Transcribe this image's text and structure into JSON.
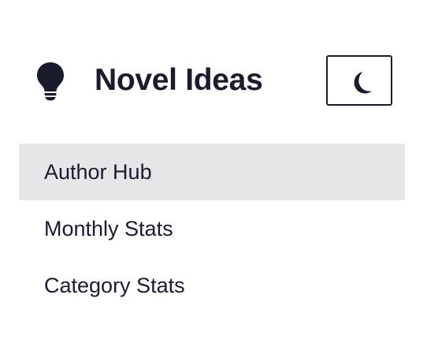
{
  "app": {
    "title": "Novel Ideas",
    "logo_icon": "lightbulb-icon"
  },
  "theme_toggle": {
    "icon": "moon-icon"
  },
  "nav": {
    "items": [
      {
        "label": "Author Hub",
        "active": true
      },
      {
        "label": "Monthly Stats",
        "active": false
      },
      {
        "label": "Category Stats",
        "active": false
      }
    ]
  },
  "colors": {
    "text": "#1a1c2e",
    "active_background": "#e6e6e9",
    "background": "#ffffff"
  }
}
